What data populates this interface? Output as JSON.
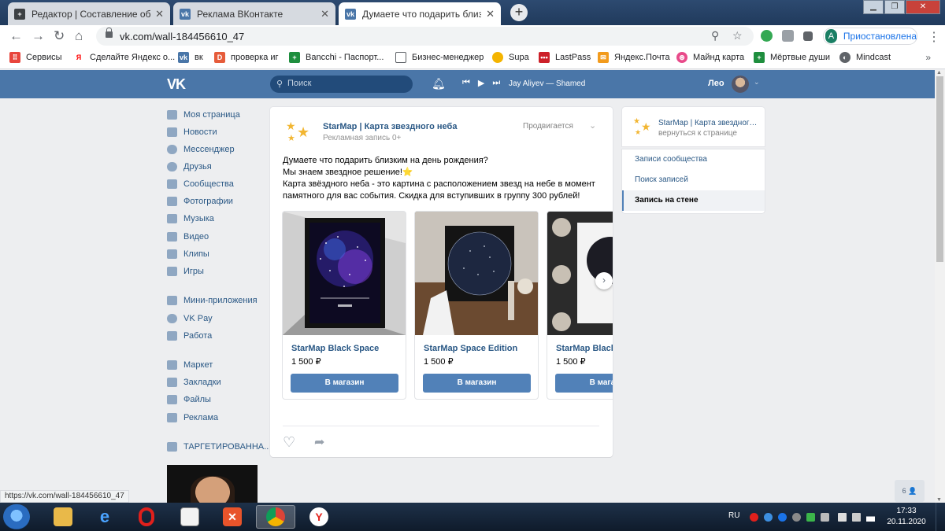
{
  "browser": {
    "tabs": [
      {
        "title": "Редактор | Составление объявлений",
        "icon": "plus-icon",
        "active": false
      },
      {
        "title": "Реклама ВКонтакте",
        "icon": "vk-icon",
        "active": false
      },
      {
        "title": "Думаете что подарить близким на день рождения",
        "icon": "vk-icon",
        "active": true
      }
    ],
    "url": "vk.com/wall-184456610_47",
    "profile_avatar": "A",
    "profile_label": "Приостановлена",
    "status_url": "https://vk.com/wall-184456610_47"
  },
  "bookmarks": [
    {
      "label": "Сервисы",
      "icon": "apps-grid-icon",
      "color": "#e8453c"
    },
    {
      "label": "Сделайте Яндекс о...",
      "icon": "yandex-icon",
      "color": "#ff0000"
    },
    {
      "label": "вк",
      "icon": "vk-icon",
      "color": "#4a76a8"
    },
    {
      "label": "проверка иг",
      "icon": "doc-icon",
      "color": "#e65c3b"
    },
    {
      "label": "Bancchi - Паспорт...",
      "icon": "sheets-icon",
      "color": "#1e8e3e"
    },
    {
      "label": "Бизнес-менеджер",
      "icon": "page-icon",
      "color": "#5f6368"
    },
    {
      "label": "Supa",
      "icon": "duck-icon",
      "color": "#f4b400"
    },
    {
      "label": "LastPass",
      "icon": "lastpass-icon",
      "color": "#cc2029"
    },
    {
      "label": "Яндекс.Почта",
      "icon": "mail-icon",
      "color": "#f29b1d"
    },
    {
      "label": "Майнд карта",
      "icon": "mindmap-icon",
      "color": "#e84a8a"
    },
    {
      "label": "Мёртвые души",
      "icon": "sheets-icon",
      "color": "#1e8e3e"
    },
    {
      "label": "Mindcast",
      "icon": "globe-icon",
      "color": "#5f6368"
    }
  ],
  "vk_header": {
    "logo": "VK",
    "search_placeholder": "Поиск",
    "track": "Jay Aliyev — Shamed",
    "user_name": "Лео"
  },
  "left_menu": [
    {
      "label": "Моя страница",
      "icon": "home-icon"
    },
    {
      "label": "Новости",
      "icon": "news-icon"
    },
    {
      "label": "Мессенджер",
      "icon": "chat-icon"
    },
    {
      "label": "Друзья",
      "icon": "user-icon"
    },
    {
      "label": "Сообщества",
      "icon": "groups-icon"
    },
    {
      "label": "Фотографии",
      "icon": "camera-icon"
    },
    {
      "label": "Музыка",
      "icon": "music-icon"
    },
    {
      "label": "Видео",
      "icon": "video-icon"
    },
    {
      "label": "Клипы",
      "icon": "clips-icon"
    },
    {
      "label": "Игры",
      "icon": "gamepad-icon"
    },
    {
      "label": "Мини-приложения",
      "icon": "apps-icon"
    },
    {
      "label": "VK Pay",
      "icon": "vkpay-icon"
    },
    {
      "label": "Работа",
      "icon": "briefcase-icon"
    },
    {
      "label": "Маркет",
      "icon": "bag-icon"
    },
    {
      "label": "Закладки",
      "icon": "star-icon"
    },
    {
      "label": "Файлы",
      "icon": "file-icon"
    },
    {
      "label": "Реклама",
      "icon": "megaphone-icon"
    },
    {
      "label": "ТАРГЕТИРОВАННА...",
      "icon": "groups-icon"
    }
  ],
  "post": {
    "author": "StarMap | Карта звездного неба",
    "subtitle": "Рекламная запись 0+",
    "promoted_label": "Продвигается",
    "text_lines": [
      "Думаете что подарить близким на день рождения?",
      "Мы знаем звездное решение!⭐",
      "Карта звёздного неба - это картина с расположением звезд на небе в момент",
      "памятного для вас события. Скидка для вступивших в группу 300 рублей!"
    ],
    "products": [
      {
        "title": "StarMap Black Space",
        "price": "1 500 ₽",
        "button": "В магазин"
      },
      {
        "title": "StarMap Space Edition",
        "price": "1 500 ₽",
        "button": "В магазин"
      },
      {
        "title": "StarMap Black Edition",
        "price": "1 500 ₽",
        "button": "В магазин"
      }
    ]
  },
  "right_panel": {
    "title": "StarMap | Карта звездного неба",
    "back_link": "вернуться к странице",
    "menu": [
      {
        "label": "Записи сообщества",
        "active": false
      },
      {
        "label": "Поиск записей",
        "active": false
      },
      {
        "label": "Запись на стене",
        "active": true
      }
    ]
  },
  "chat_badge": "6 👤",
  "taskbar": {
    "lang": "RU",
    "time": "17:33",
    "date": "20.11.2020"
  },
  "colors": {
    "vk_blue": "#4a76a8",
    "vk_link": "#2a5885",
    "vk_button": "#5181b8",
    "page_bg": "#edeef0"
  }
}
